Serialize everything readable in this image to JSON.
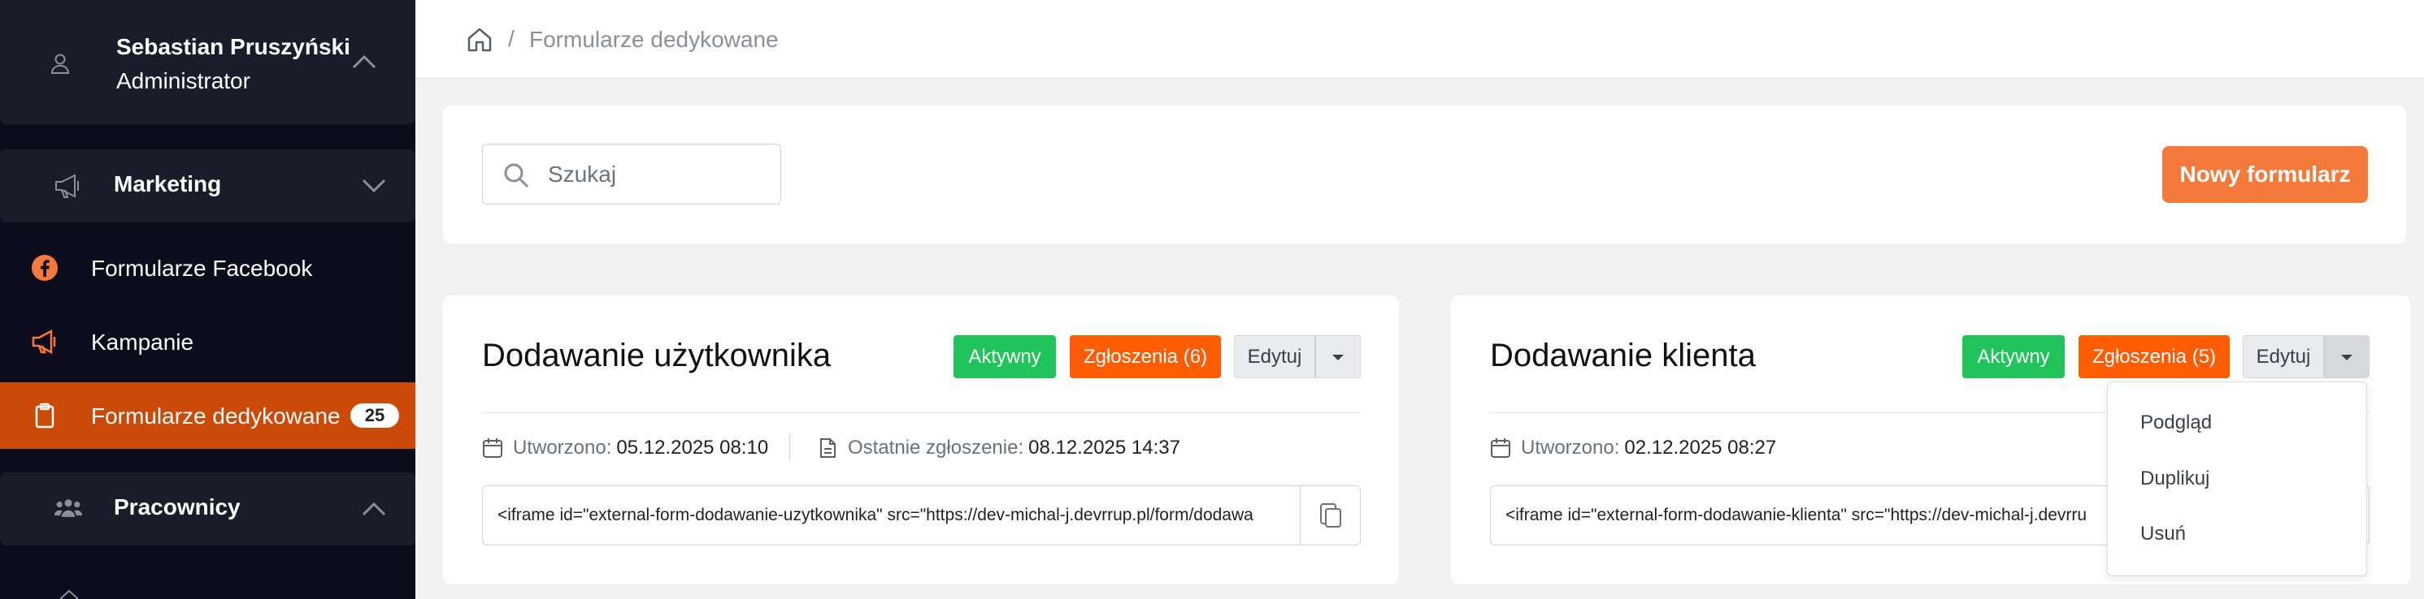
{
  "user": {
    "name": "Sebastian Pruszyński",
    "role": "Administrator"
  },
  "sidebar": {
    "sections": [
      {
        "label": "Marketing",
        "icon": "megaphone-icon",
        "expanded": true
      },
      {
        "label": "Pracownicy",
        "icon": "users-icon",
        "expanded": false
      }
    ],
    "items": [
      {
        "label": "Formularze Facebook",
        "icon": "facebook-icon"
      },
      {
        "label": "Kampanie",
        "icon": "megaphone-icon"
      },
      {
        "label": "Formularze dedykowane",
        "icon": "clipboard-icon",
        "badge": "25",
        "active": true
      }
    ]
  },
  "breadcrumb": {
    "separator": "/",
    "current": "Formularze dedykowane"
  },
  "toolbar": {
    "search_placeholder": "Szukaj",
    "new_button": "Nowy formularz"
  },
  "forms": [
    {
      "title": "Dodawanie użytkownika",
      "status": "Aktywny",
      "submissions_button": "Zgłoszenia (6)",
      "edit_button": "Edytuj",
      "created_label": "Utworzono:",
      "created_value": "05.12.2025 08:10",
      "last_submission_label": "Ostatnie zgłoszenie:",
      "last_submission_value": "08.12.2025 14:37",
      "embed_code": "<iframe id=\"external-form-dodawanie-uzytkownika\" src=\"https://dev-michal-j.devrrup.pl/form/dodawa"
    },
    {
      "title": "Dodawanie klienta",
      "status": "Aktywny",
      "submissions_button": "Zgłoszenia (5)",
      "edit_button": "Edytuj",
      "created_label": "Utworzono:",
      "created_value": "02.12.2025 08:27",
      "embed_code": "<iframe id=\"external-form-dodawanie-klienta\" src=\"https://dev-michal-j.devrru"
    }
  ],
  "dropdown": {
    "items": [
      "Podgląd",
      "Duplikuj",
      "Usuń"
    ]
  },
  "colors": {
    "accent": "#f47a3c",
    "active_nav": "#cc4a08",
    "status_green": "#21c45a",
    "submissions_orange": "#ff5d05",
    "sidebar_bg": "#0c0c1c"
  }
}
